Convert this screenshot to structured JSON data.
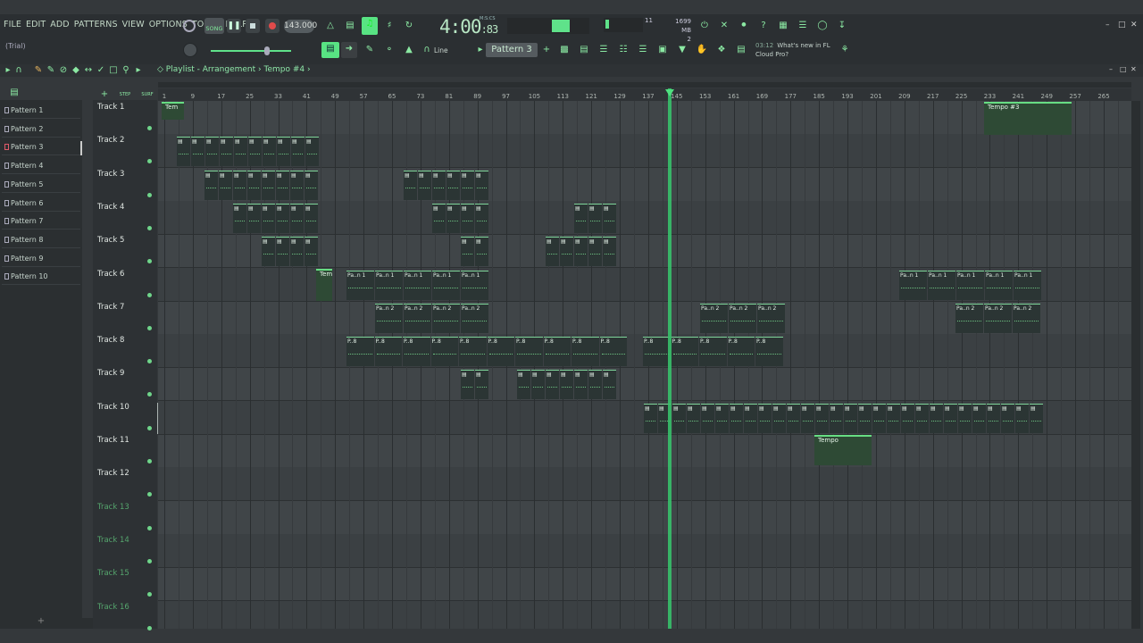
{
  "menu": {
    "file": "FILE",
    "edit": "EDIT",
    "add": "ADD",
    "patterns": "PATTERNS",
    "view": "VIEW",
    "options": "OPTIONS",
    "tools": "TOOLS",
    "help": "HELP"
  },
  "trial": "(Trial)",
  "transport": {
    "mode": "SONG",
    "tempo": "143.000",
    "time_main": "4:00",
    "time_sub": ":83",
    "time_unit": "M:S:CS"
  },
  "monitor": {
    "cpu": "11",
    "memory": "1699 MB",
    "voices": "2"
  },
  "pattern_selector": "Pattern 3",
  "snap": "Line",
  "news": {
    "time": "03:12",
    "text_line1": "What's new in FL",
    "text_line2": "Cloud Pro?"
  },
  "breadcrumb": {
    "title": "Playlist - Arrangement",
    "sep": "›",
    "item": "Tempo #4"
  },
  "ruler": {
    "ticks": [
      "1",
      "9",
      "17",
      "25",
      "33",
      "41",
      "49",
      "57",
      "65",
      "73",
      "81",
      "89",
      "97",
      "105",
      "113",
      "121",
      "129",
      "137",
      "145",
      "153",
      "161",
      "169",
      "177",
      "185",
      "193",
      "201",
      "209",
      "217",
      "225",
      "233",
      "241",
      "249",
      "257",
      "265"
    ]
  },
  "patterns": [
    "Pattern 1",
    "Pattern 2",
    "Pattern 3",
    "Pattern 4",
    "Pattern 5",
    "Pattern 6",
    "Pattern 7",
    "Pattern 8",
    "Pattern 9",
    "Pattern 10"
  ],
  "selected_pattern_index": 2,
  "tracks": [
    "Track 1",
    "Track 2",
    "Track 3",
    "Track 4",
    "Track 5",
    "Track 6",
    "Track 7",
    "Track 8",
    "Track 9",
    "Track 10",
    "Track 11",
    "Track 12",
    "Track 13",
    "Track 14",
    "Track 15",
    "Track 16"
  ],
  "clip_labels": {
    "p1": "Pa..n 1",
    "p2": "Pa..n 2",
    "p8": "P..8",
    "tempo": "Tempo",
    "tempo3": "Tempo #3",
    "tempo4": "Tem"
  },
  "colors": {
    "accent": "#7fe89a",
    "playhead": "#37c06a",
    "background": "#34383b"
  }
}
